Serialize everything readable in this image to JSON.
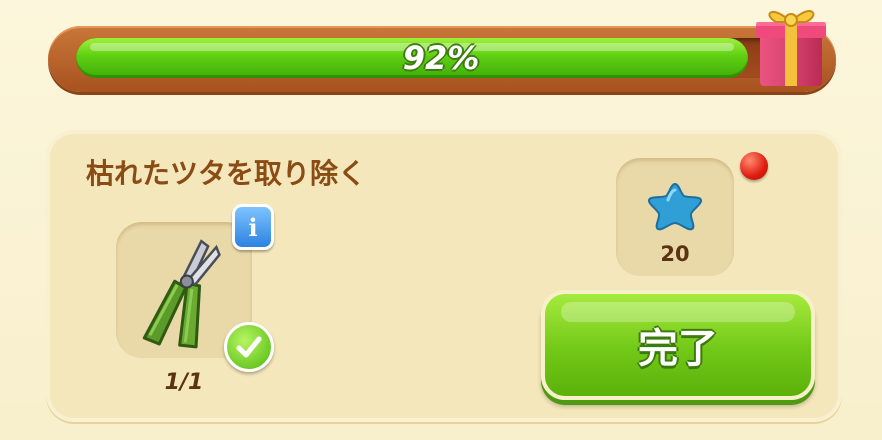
{
  "progress": {
    "percent": 92,
    "label": "92%"
  },
  "task": {
    "title": "枯れたツタを取り除く",
    "tool": {
      "name": "pruning-shears",
      "count": "1/1",
      "info": "i"
    },
    "reward": {
      "icon": "blue-star-icon",
      "amount": "20"
    },
    "complete_label": "完了"
  },
  "colors": {
    "progress_green": "#5fcf12",
    "frame_brown": "#a8521f",
    "title_brown": "#8a4b14",
    "button_green": "#72c817",
    "notify_red": "#e01c10",
    "star_blue": "#2f9fd6"
  }
}
